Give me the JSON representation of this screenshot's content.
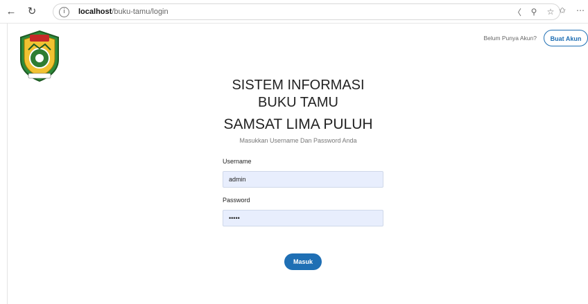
{
  "browser": {
    "url_host": "localhost",
    "url_path": "/buku-tamu/login",
    "icons": [
      "back-arrow-icon",
      "refresh-icon",
      "info-icon",
      "read-aloud-icon",
      "zoom-icon",
      "favorite-star-icon",
      "favorites-list-icon",
      "more-icon"
    ]
  },
  "header": {
    "account_prompt": "Belum Punya Akun?",
    "create_account_label": "Buat Akun"
  },
  "title": {
    "line1": "SISTEM INFORMASI",
    "line2": "BUKU TAMU",
    "line3": "SAMSAT LIMA PULUH",
    "subtitle": "Masukkan Username Dan Password Anda"
  },
  "form": {
    "username_label": "Username",
    "username_value": "admin",
    "password_label": "Password",
    "password_value": "admin",
    "submit_label": "Masuk"
  },
  "colors": {
    "accent": "#1f6fb4",
    "input_bg": "#e8eefd"
  }
}
